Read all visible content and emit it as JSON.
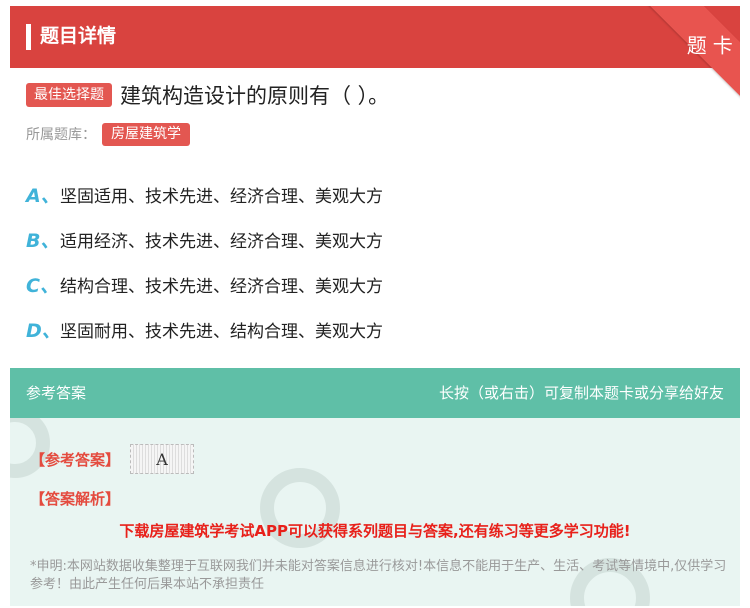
{
  "header": {
    "title": "题目详情",
    "ribbon": "题卡"
  },
  "question": {
    "type_tag": "最佳选择题",
    "text": "建筑构造设计的原则有（ ）。",
    "category_label": "所属题库：",
    "category": "房屋建筑学"
  },
  "options": [
    {
      "letter": "A、",
      "text": "坚固适用、技术先进、经济合理、美观大方"
    },
    {
      "letter": "B、",
      "text": "适用经济、技术先进、经济合理、美观大方"
    },
    {
      "letter": "C、",
      "text": "结构合理、技术先进、经济合理、美观大方"
    },
    {
      "letter": "D、",
      "text": "坚固耐用、技术先进、结构合理、美观大方"
    }
  ],
  "answer": {
    "head_left": "参考答案",
    "head_right": "长按（或右击）可复制本题卡或分享给好友",
    "ref_label": "【参考答案】",
    "ref_value": "A",
    "analysis_label": "【答案解析】",
    "promo": "下载房屋建筑学考试APP可以获得系列题目与答案,还有练习等更多学习功能!",
    "disclaimer": "*申明:本网站数据收集整理于互联网我们并未能对答案信息进行核对!本信息不能用于生产、生活、考试等情境中,仅供学习参考！由此产生任何后果本站不承担责任"
  },
  "colors": {
    "header": "#d9433f",
    "tag": "#e35751",
    "option_letter": "#40b3d9",
    "answer_head": "#5fbfa7",
    "answer_bg": "#e9f5f2",
    "promo": "#e8201a"
  }
}
